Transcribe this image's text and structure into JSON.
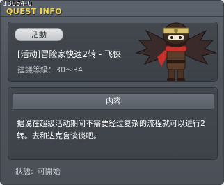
{
  "window": {
    "quest_id": "13054-0",
    "title": "QUEST INFO"
  },
  "quest": {
    "category": "活動",
    "name": "[活动]冒险家快速2转 - 飞侠",
    "level_requirement": "建議等級：30～34"
  },
  "npc": {
    "icon": "ninja-npc-portrait"
  },
  "content": {
    "header": "内容",
    "text": "据说在超级活动期间不需要经过复杂的流程就可以进行2转。去和达克鲁谈谈吧。"
  },
  "status": {
    "label": "狀態:",
    "value": "可開始"
  },
  "colors": {
    "title": "#f2d24a",
    "panel_bg": "#43484f",
    "frame_bg": "#5d636c",
    "header_bg": "#6a7079"
  }
}
